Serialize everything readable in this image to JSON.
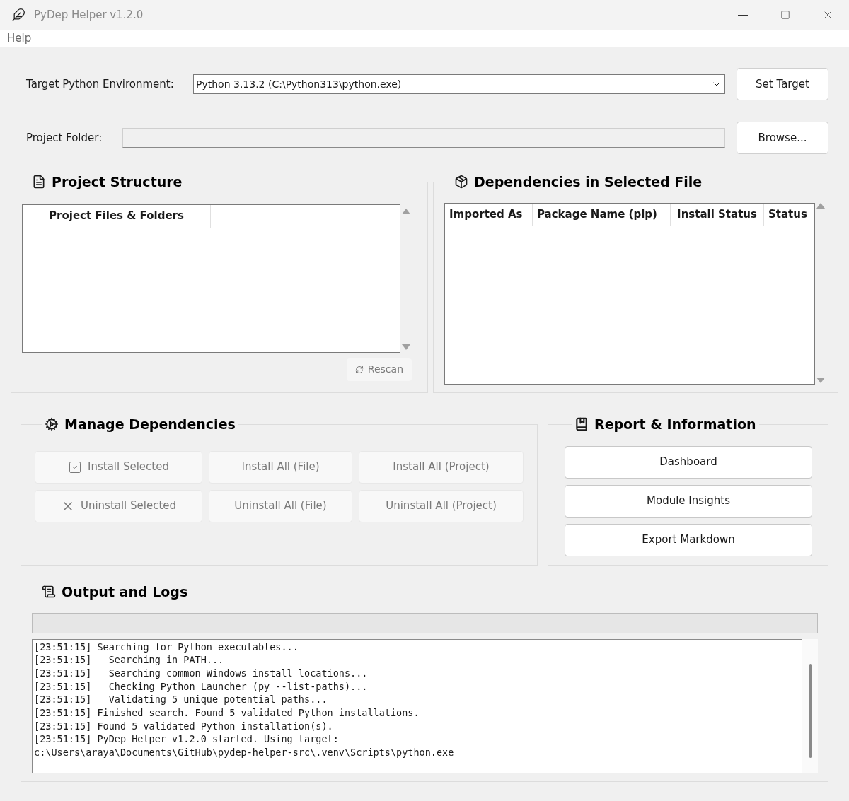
{
  "window": {
    "title": "PyDep Helper v1.2.0"
  },
  "menu": [
    "Help"
  ],
  "target": {
    "label": "Target Python Environment:",
    "value": "Python 3.13.2 (C:\\Python313\\python.exe)",
    "button": "Set Target"
  },
  "project_folder": {
    "label": "Project Folder:",
    "button": "Browse..."
  },
  "project_structure": {
    "title": "Project Structure",
    "columns": [
      "Project Files & Folders"
    ],
    "rescan": {
      "label": "Rescan",
      "disabled": true
    }
  },
  "dependencies": {
    "title": "Dependencies in Selected File",
    "columns": [
      "Imported As",
      "Package Name (pip)",
      "Install Status",
      "Status"
    ]
  },
  "manage": {
    "title": "Manage Dependencies",
    "buttons": [
      {
        "label": "Install Selected",
        "disabled": true
      },
      {
        "label": "Install All (File)",
        "disabled": true
      },
      {
        "label": "Install All (Project)",
        "disabled": true
      },
      {
        "label": "Uninstall Selected",
        "disabled": true
      },
      {
        "label": "Uninstall All (File)",
        "disabled": true
      },
      {
        "label": "Uninstall All (Project)",
        "disabled": true
      }
    ]
  },
  "report": {
    "title": "Report & Information",
    "buttons": [
      "Dashboard",
      "Module Insights",
      "Export Markdown"
    ]
  },
  "output": {
    "title": "Output and Logs",
    "progress": {
      "level": 0
    },
    "lines": [
      "[23:51:15] Searching for Python executables...",
      "[23:51:15]   Searching in PATH...",
      "[23:51:15]   Searching common Windows install locations...",
      "[23:51:15]   Checking Python Launcher (py --list-paths)...",
      "[23:51:15]   Validating 5 unique potential paths...",
      "[23:51:15] Finished search. Found 5 validated Python installations.",
      "[23:51:15] Found 5 validated Python installation(s).",
      "[23:51:15] PyDep Helper v1.2.0 started. Using target:",
      "c:\\Users\\araya\\Documents\\GitHub\\pydep-helper-src\\.venv\\Scripts\\python.exe"
    ]
  }
}
